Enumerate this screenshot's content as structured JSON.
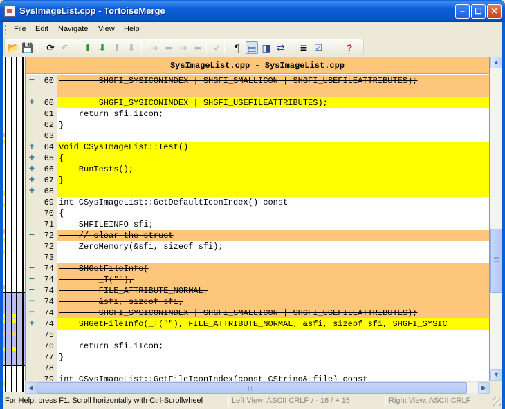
{
  "window": {
    "title": "SysImageList.cpp - TortoiseMerge",
    "min_symbol": "–",
    "max_symbol": "☐",
    "close_symbol": "✕"
  },
  "menu": [
    "File",
    "Edit",
    "Navigate",
    "View",
    "Help"
  ],
  "toolbar": [
    {
      "icon": "open-folder-icon",
      "glyph": "📂",
      "enabled": true
    },
    {
      "icon": "save-icon",
      "glyph": "💾",
      "enabled": false
    },
    {
      "icon": "reload-icon",
      "glyph": "⟳",
      "enabled": true
    },
    {
      "icon": "undo-icon",
      "glyph": "↶",
      "enabled": false
    },
    {
      "icon": "next-difference-icon",
      "glyph": "⬆",
      "enabled": true,
      "color": "#1f9a2a"
    },
    {
      "icon": "previous-difference-icon",
      "glyph": "⬇",
      "enabled": true,
      "color": "#1f9a2a"
    },
    {
      "icon": "next-conflict-icon",
      "glyph": "⬆",
      "enabled": false
    },
    {
      "icon": "previous-conflict-icon",
      "glyph": "⬇",
      "enabled": false
    },
    {
      "icon": "use-theirs-icon",
      "glyph": "➔",
      "enabled": false
    },
    {
      "icon": "use-mine-icon",
      "glyph": "⬅",
      "enabled": false
    },
    {
      "icon": "use-theirs-then-mine-icon",
      "glyph": "➔",
      "enabled": false
    },
    {
      "icon": "use-mine-then-theirs-icon",
      "glyph": "⬅",
      "enabled": false
    },
    {
      "icon": "mark-resolved-icon",
      "glyph": "✓",
      "enabled": false
    },
    {
      "icon": "whitespace-icon",
      "glyph": "¶",
      "enabled": true
    },
    {
      "icon": "one-pane-view-icon",
      "glyph": "▤",
      "enabled": true,
      "pressed": true,
      "color": "#4a6aa8"
    },
    {
      "icon": "two-pane-view-icon",
      "glyph": "◨",
      "enabled": true,
      "color": "#2a4a98"
    },
    {
      "icon": "switch-panes-icon",
      "glyph": "⇄",
      "enabled": true,
      "color": "#2a4a98"
    },
    {
      "icon": "line-diff-bar-icon",
      "glyph": "≣",
      "enabled": true
    },
    {
      "icon": "settings-icon",
      "glyph": "☑",
      "enabled": true,
      "color": "#3060c0"
    },
    {
      "icon": "help-icon",
      "glyph": "?",
      "enabled": true,
      "color": "#d01010"
    }
  ],
  "pane": {
    "header": "SysImageList.cpp - SysImageList.cpp"
  },
  "lines": [
    {
      "state": "removed",
      "marker": "−",
      "num": "60",
      "text": "        SHGFI_SYSICONINDEX | SHGFI_SMALLICON | SHGFI_USEFILEATTRIBUTES);"
    },
    {
      "state": "empty",
      "marker": "",
      "num": "",
      "text": ""
    },
    {
      "state": "added",
      "marker": "+",
      "num": "60",
      "text": "        SHGFI_SYSICONINDEX | SHGFI_USEFILEATTRIBUTES);"
    },
    {
      "state": "normal",
      "marker": "",
      "num": "61",
      "text": "    return sfi.iIcon;"
    },
    {
      "state": "normal",
      "marker": "",
      "num": "62",
      "text": "}"
    },
    {
      "state": "normal",
      "marker": "",
      "num": "63",
      "text": ""
    },
    {
      "state": "added",
      "marker": "+",
      "num": "64",
      "text": "void CSysImageList::Test()"
    },
    {
      "state": "added",
      "marker": "+",
      "num": "65",
      "text": "{"
    },
    {
      "state": "added",
      "marker": "+",
      "num": "66",
      "text": "    RunTests();"
    },
    {
      "state": "added",
      "marker": "+",
      "num": "67",
      "text": "}"
    },
    {
      "state": "added",
      "marker": "+",
      "num": "68",
      "text": ""
    },
    {
      "state": "normal",
      "marker": "",
      "num": "69",
      "text": "int CSysImageList::GetDefaultIconIndex() const"
    },
    {
      "state": "normal",
      "marker": "",
      "num": "70",
      "text": "{"
    },
    {
      "state": "normal",
      "marker": "",
      "num": "71",
      "text": "    SHFILEINFO sfi;"
    },
    {
      "state": "removed",
      "marker": "−",
      "num": "72",
      "text": "    // clear the struct"
    },
    {
      "state": "normal",
      "marker": "",
      "num": "72",
      "text": "    ZeroMemory(&sfi, sizeof sfi);"
    },
    {
      "state": "normal",
      "marker": "",
      "num": "73",
      "text": ""
    },
    {
      "state": "removed",
      "marker": "−",
      "num": "74",
      "text": "    SHGetFileInfo("
    },
    {
      "state": "removed",
      "marker": "−",
      "num": "74",
      "text": "        _T(\"\"),"
    },
    {
      "state": "removed",
      "marker": "−",
      "num": "74",
      "text": "        FILE_ATTRIBUTE_NORMAL,"
    },
    {
      "state": "removed",
      "marker": "−",
      "num": "74",
      "text": "        &sfi, sizeof sfi,"
    },
    {
      "state": "removed",
      "marker": "−",
      "num": "74",
      "text": "        SHGFI_SYSICONINDEX | SHGFI_SMALLICON | SHGFI_USEFILEATTRIBUTES);"
    },
    {
      "state": "added",
      "marker": "+",
      "num": "74",
      "text": "    SHGetFileInfo(_T(\"\"), FILE_ATTRIBUTE_NORMAL, &sfi, sizeof sfi, SHGFI_SYSIC"
    },
    {
      "state": "normal",
      "marker": "",
      "num": "75",
      "text": ""
    },
    {
      "state": "normal",
      "marker": "",
      "num": "76",
      "text": "    return sfi.iIcon;"
    },
    {
      "state": "normal",
      "marker": "",
      "num": "77",
      "text": "}"
    },
    {
      "state": "normal",
      "marker": "",
      "num": "78",
      "text": ""
    },
    {
      "state": "normal",
      "marker": "",
      "num": "79",
      "text": "int CSysImageList::GetFileIconIndex(const CString& file) const"
    }
  ],
  "status": {
    "help": "For Help, press F1. Scroll horizontally with Ctrl-Scrollwheel",
    "left_view": "Left View: ASCII CRLF",
    "diff_counts": "/ - 16 / + 15",
    "right_view": "Right View: ASCII CRLF"
  },
  "colors": {
    "removed": "#fdc67a",
    "added": "#ffff00",
    "marker": "#2a7aa0",
    "titlebar": "#0b5ed6"
  }
}
